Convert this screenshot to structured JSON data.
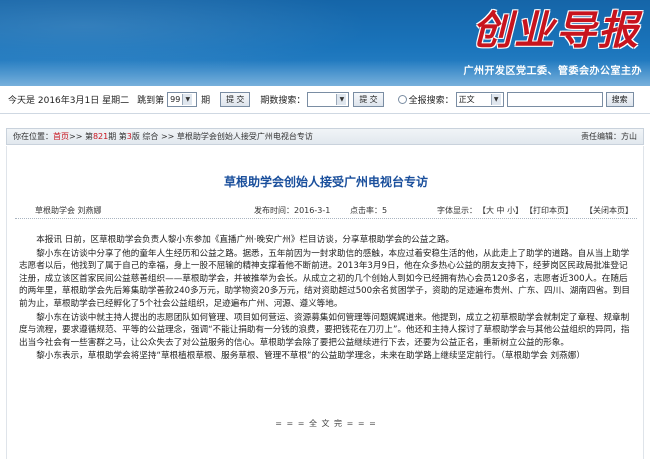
{
  "header": {
    "masthead": "创业导报",
    "subtitle": "广州开发区党工委、管委会办公室主办"
  },
  "toolbar": {
    "date_text": "今天是 2016年3月1日 星期二",
    "jump_label": "跳到第",
    "issue_value": "99",
    "issue_unit": "期",
    "submit_label": "提 交",
    "issue_search_label": "期数搜索：",
    "submit2_label": "提 交",
    "fulltext_label": "全报搜索：",
    "fulltext_option": "正文",
    "search_label": "搜索"
  },
  "breadcrumb": {
    "prefix": "你在位置：",
    "home": "首页",
    "sep1": " >> 第 ",
    "issue_no": "821",
    "issue_label": " 期 第 ",
    "page_no": "3",
    "page_label": " 版 综合 >> 草根助学会创始人接受广州电视台专访",
    "editor": "责任编辑：方山"
  },
  "article": {
    "title": "草根助学会创始人接受广州电视台专访",
    "author": "草根助学会 刘燕娜",
    "publish_time": "发布时间：2016-3-1",
    "clicks": "点击率：5",
    "font_size_label": "字体显示：",
    "font_big": "大",
    "font_mid": "中",
    "font_small": "小",
    "print": "【打印本页】",
    "close": "【关闭本页】",
    "paragraphs": [
      "本报讯 日前，区草根助学会负责人黎小东参加《直播广州·晚安广州》栏目访谈，分享草根助学会的公益之路。",
      "黎小东在访谈中分享了他的童年人生经历和公益之路。据悉，五年前因为一封求助信的感触，本应过着安稳生活的他，从此走上了助学的道路。自从当上助学志愿者以后，他找到了属于自己的幸福，身上一股不屈输的精神支撑着他不断前进。2013年3月9日，他在众多热心公益的朋友支持下，经萝岗区民政局批准登记注册，成立该区首家民间公益慈善组织——草根助学会，并被推举为会长。从成立之初的几个创始人到如今已经拥有热心会员120多名，志愿者近300人。在随后的两年里，草根助学会先后筹集助学善款240多万元，助学物资20多万元，结对资助超过500余名贫困学子，资助的足迹遍布贵州、广东、四川、湖南四省。到目前为止，草根助学会已经孵化了5个社会公益组织，足迹遍布广州、河源、遵义等地。",
      "黎小东在访谈中就主持人提出的志愿团队如何管理、项目如何营运、资源募集如何管理等问题娓娓道来。他提到，成立之初草根助学会就制定了章程、规章制度与流程，要求遵循规范、平等的公益理念，强调“不能让捐助有一分钱的浪费，要把钱花在刀刃上”。他还和主持人探讨了草根助学会与其他公益组织的异同，指出当今社会有一些害群之马，让公众失去了对公益服务的信心。草根助学会除了要把公益继续进行下去，还要为公益正名，重新树立公益的形象。",
      "黎小东表示，草根助学会将坚持“草根植根草根、服务草根、管理不草根”的公益助学理念，未来在助学路上继续坚定前行。（草根助学会 刘燕娜）"
    ],
    "endmark": "= = = 全 文 完 = = ="
  }
}
